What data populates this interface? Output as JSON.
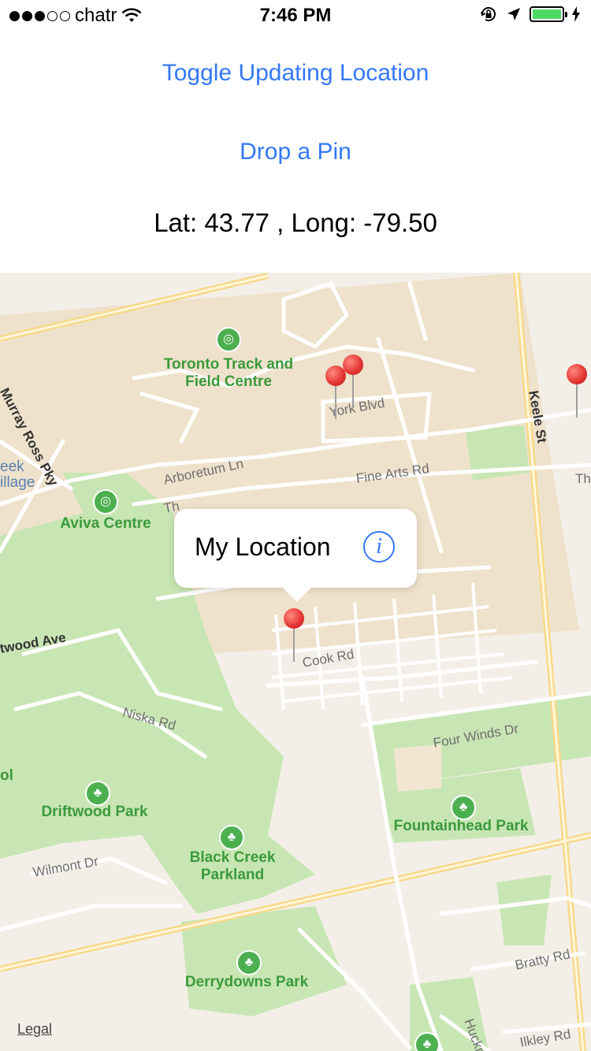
{
  "status_bar": {
    "carrier": "chatr",
    "time": "7:46 PM",
    "signal_dots": 5,
    "signal_full": 3,
    "battery_level": 1.0
  },
  "buttons": {
    "toggle_label": "Toggle Updating Location",
    "drop_label": "Drop a Pin"
  },
  "coords": "Lat: 43.77 , Long: -79.50",
  "map": {
    "callout_title": "My Location",
    "info_symbol": "i",
    "legal": "Legal",
    "streets": [
      "York Blvd",
      "Arboretum Ln",
      "Fine Arts Rd",
      "Keele St",
      "Murray Ross Pky",
      "Cook Rd",
      "Niska Rd",
      "Four Winds Dr",
      "Wilmont Dr",
      "Bratty Rd",
      "Ilkley Rd",
      "twood Ave",
      "Huckn",
      "Th",
      "Th",
      "eek",
      "illage"
    ],
    "places": [
      "Toronto Track and Field Centre",
      "Aviva Centre",
      "Driftwood Park",
      "Black Creek Parkland",
      "Fountainhead Park",
      "Derrydowns Park",
      "ol"
    ],
    "icons": {
      "stadium": "stadium-icon",
      "park": "tree-icon"
    },
    "colors": {
      "park": "#c8e6b4",
      "campus": "#f2e6d3",
      "road": "#ffffff",
      "major_road": "#f7d98b",
      "pin": "#e53935"
    }
  }
}
